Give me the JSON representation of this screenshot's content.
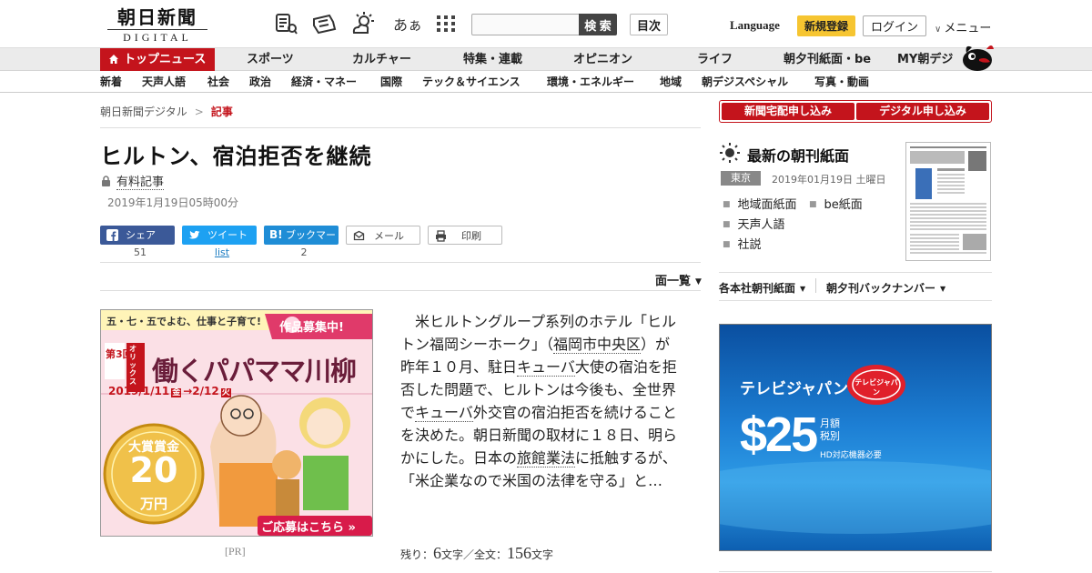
{
  "header": {
    "logo_jp": "朝日新聞",
    "logo_en": "DIGITAL",
    "search_placeholder": "",
    "search_label": "検 索",
    "toc_label": "目次",
    "language_label": "Language",
    "register_label": "新規登録",
    "login_label": "ログイン",
    "menu_label": "メニュー",
    "font_size_icon_label": "あぁ"
  },
  "nav_primary": {
    "top_label": "トップニュース",
    "items": [
      "スポーツ",
      "カルチャー",
      "特集・連載",
      "オピニオン",
      "ライフ",
      "朝夕刊紙面・be",
      "MY朝デジ"
    ]
  },
  "nav_secondary": {
    "items": [
      "新着",
      "天声人語",
      "社会",
      "政治",
      "経済・マネー",
      "国際",
      "テック＆サイエンス",
      "環境・エネルギー",
      "地域",
      "朝デジスペシャル",
      "写真・動画"
    ]
  },
  "breadcrumb": {
    "home": "朝日新聞デジタル",
    "separator": ">",
    "current": "記事"
  },
  "article": {
    "title": "ヒルトン、宿泊拒否を継続",
    "paid_label": "有料記事",
    "date": "2019年1月19日05時00分",
    "share": {
      "facebook_label": "シェア",
      "facebook_count": "51",
      "twitter_label": "ツイート",
      "twitter_count": "list",
      "hatena_label": "ブックマーク",
      "hatena_count": "2",
      "mail_label": "メール",
      "print_label": "印刷"
    },
    "menu_link": "面一覧",
    "body_parts": {
      "p1": "　米ヒルトングループ系列のホテル「ヒルトン福岡シーホーク」（",
      "l1": "福岡市中央区",
      "p2": "）が昨年１０月、駐日",
      "l2": "キューバ",
      "p3": "大使の宿泊を拒否した問題で、ヒルトンは今後も、全世界で",
      "l3": "キューバ",
      "p4": "外交官の宿泊拒否を続けることを決めた。朝日新聞の取材に１８日、明らかにした。日本の",
      "l4": "旅館業法",
      "p5": "に抵触するが、「米企業なので米国の法律を守る」と…"
    },
    "remaining_prefix": "残り：",
    "remaining_count": "6",
    "remaining_unit": "文字／全文：",
    "total_count": "156",
    "total_unit": "文字"
  },
  "ad_left": {
    "tag": "[PR]",
    "headline_top": "五・七・五でよむ、仕事と子育て!",
    "ribbon": "作品募集中!",
    "round": "第3回",
    "sponsor": "オリックス",
    "title": "働くパパママ川柳",
    "period": "2019/1/11",
    "period_start_day": "金",
    "period_end": "2/12",
    "period_end_day": "火",
    "prize_label": "大賞賞金",
    "prize_amount": "20",
    "prize_unit": "万円",
    "cta": "ご応募はこちら"
  },
  "sidebar": {
    "delivery_label": "新聞宅配申し込み",
    "digital_label": "デジタル申し込み",
    "edition_title": "最新の朝刊紙面",
    "city": "東京",
    "edition_date": "2019年01月19日 土曜日",
    "links": [
      "地域面紙面",
      "be紙面",
      "天声人語",
      "社説"
    ],
    "dropdown_a": "各本社朝刊紙面",
    "dropdown_b": "朝夕刊バックナンバー"
  },
  "ad_right": {
    "brand": "テレビジャパン",
    "brand_badge": "テレビジャパン",
    "price": "$25",
    "price_note_1": "月額",
    "price_note_2": "税別",
    "note": "HD対応機器必要"
  },
  "colors": {
    "brand_red": "#c4141c",
    "register_yellow": "#f6c531",
    "facebook": "#3b5998",
    "twitter": "#1da1f2",
    "hatena": "#1f8dd6"
  }
}
